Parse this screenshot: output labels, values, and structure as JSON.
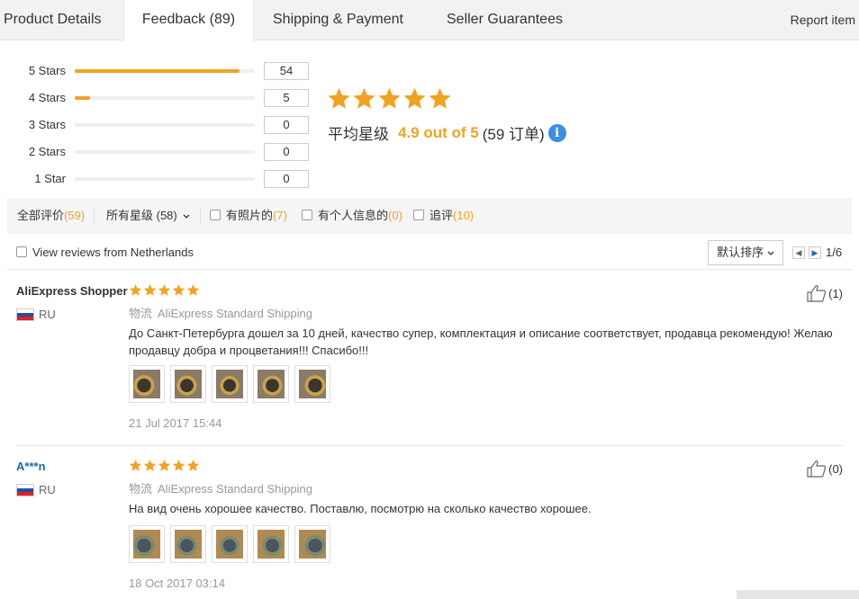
{
  "tabs": [
    {
      "label": "Product Details"
    },
    {
      "label": "Feedback (89)"
    },
    {
      "label": "Shipping & Payment"
    },
    {
      "label": "Seller Guarantees"
    }
  ],
  "report_label": "Report item",
  "distribution": [
    {
      "label": "5 Stars",
      "count": "54",
      "fraction": 0.915
    },
    {
      "label": "4 Stars",
      "count": "5",
      "fraction": 0.085
    },
    {
      "label": "3 Stars",
      "count": "0",
      "fraction": 0
    },
    {
      "label": "2 Stars",
      "count": "0",
      "fraction": 0
    },
    {
      "label": "1 Star",
      "count": "0",
      "fraction": 0
    }
  ],
  "summary": {
    "stars": 5,
    "label": "平均星级",
    "score": "4.9 out of 5",
    "orders": "(59 订单)",
    "info_icon": "info-icon"
  },
  "filters": {
    "all_label": "全部评价",
    "all_count": "(59)",
    "stars_dropdown": "所有星级 (58)",
    "photos_label": "有照片的",
    "photos_count": "(7)",
    "personal_label": "有个人信息的",
    "personal_count": "(0)",
    "followup_label": "追评",
    "followup_count": "(10)"
  },
  "view": {
    "checkbox_label": "View reviews from Netherlands",
    "sort_label": "默认排序",
    "page": "1/6"
  },
  "reviews": [
    {
      "name": "AliExpress Shopper",
      "country": "RU",
      "stars": 5,
      "shipping_label": "物流",
      "shipping": "AliExpress Standard Shipping",
      "text": "До Санкт-Петербурга дошел за 10 дней, качество супер, комплектация и описание соответствует, продавца рекомендую! Желаю продавцу добра и процветания!!! Спасибо!!!",
      "photo_count": 5,
      "date": "21 Jul 2017 15:44",
      "likes": "(1)"
    },
    {
      "name": "A***n",
      "country": "RU",
      "stars": 5,
      "shipping_label": "物流",
      "shipping": "AliExpress Standard Shipping",
      "text": "На вид очень хорошее качество. Поставлю, посмотрю на сколько качество хорошее.",
      "photo_count": 5,
      "date": "18 Oct 2017 03:14",
      "likes": "(0)"
    }
  ],
  "colors": {
    "accent": "#f0a323",
    "link_blue": "#1a6bb8",
    "info_blue": "#3a8ee6"
  }
}
